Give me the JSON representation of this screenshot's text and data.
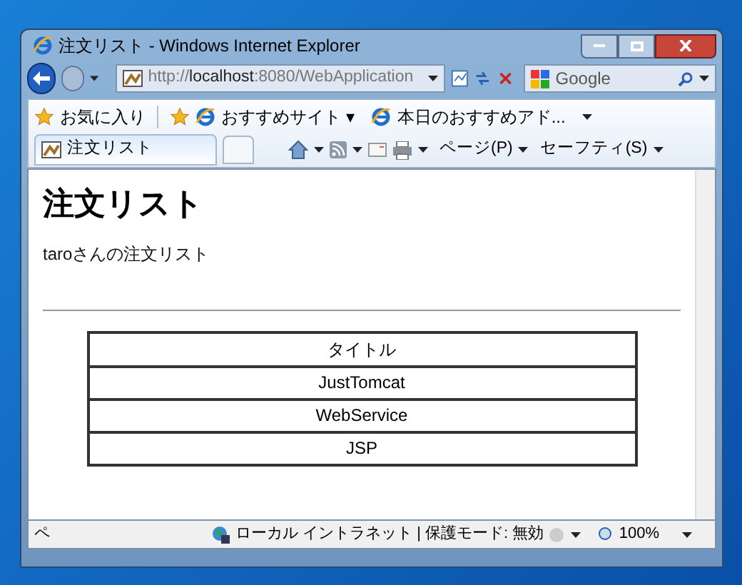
{
  "window": {
    "title": "注文リスト - Windows Internet Explorer"
  },
  "address_bar": {
    "url": "http://**localhost**:8080/WebApplication"
  },
  "search": {
    "placeholder": "Google"
  },
  "favorites_bar": {
    "favorites": "お気に入り",
    "links": [
      "おすすめサイト ▾",
      "本日のおすすめアド..."
    ]
  },
  "tabs": [
    {
      "label": "注文リスト",
      "selected": true
    }
  ],
  "command_bar": {
    "page": "ページ(P)",
    "safety": "セーフティ(S)"
  },
  "page": {
    "heading": "注文リスト",
    "subtitle": "taroさんの注文リスト",
    "table": {
      "columns": [
        "タイトル"
      ],
      "rows": [
        "JustTomcat",
        "WebService",
        "JSP"
      ]
    }
  },
  "status_bar": {
    "left": "ペ",
    "zone": "ローカル イントラネット | 保護モード: 無効",
    "zoom": "100%"
  }
}
